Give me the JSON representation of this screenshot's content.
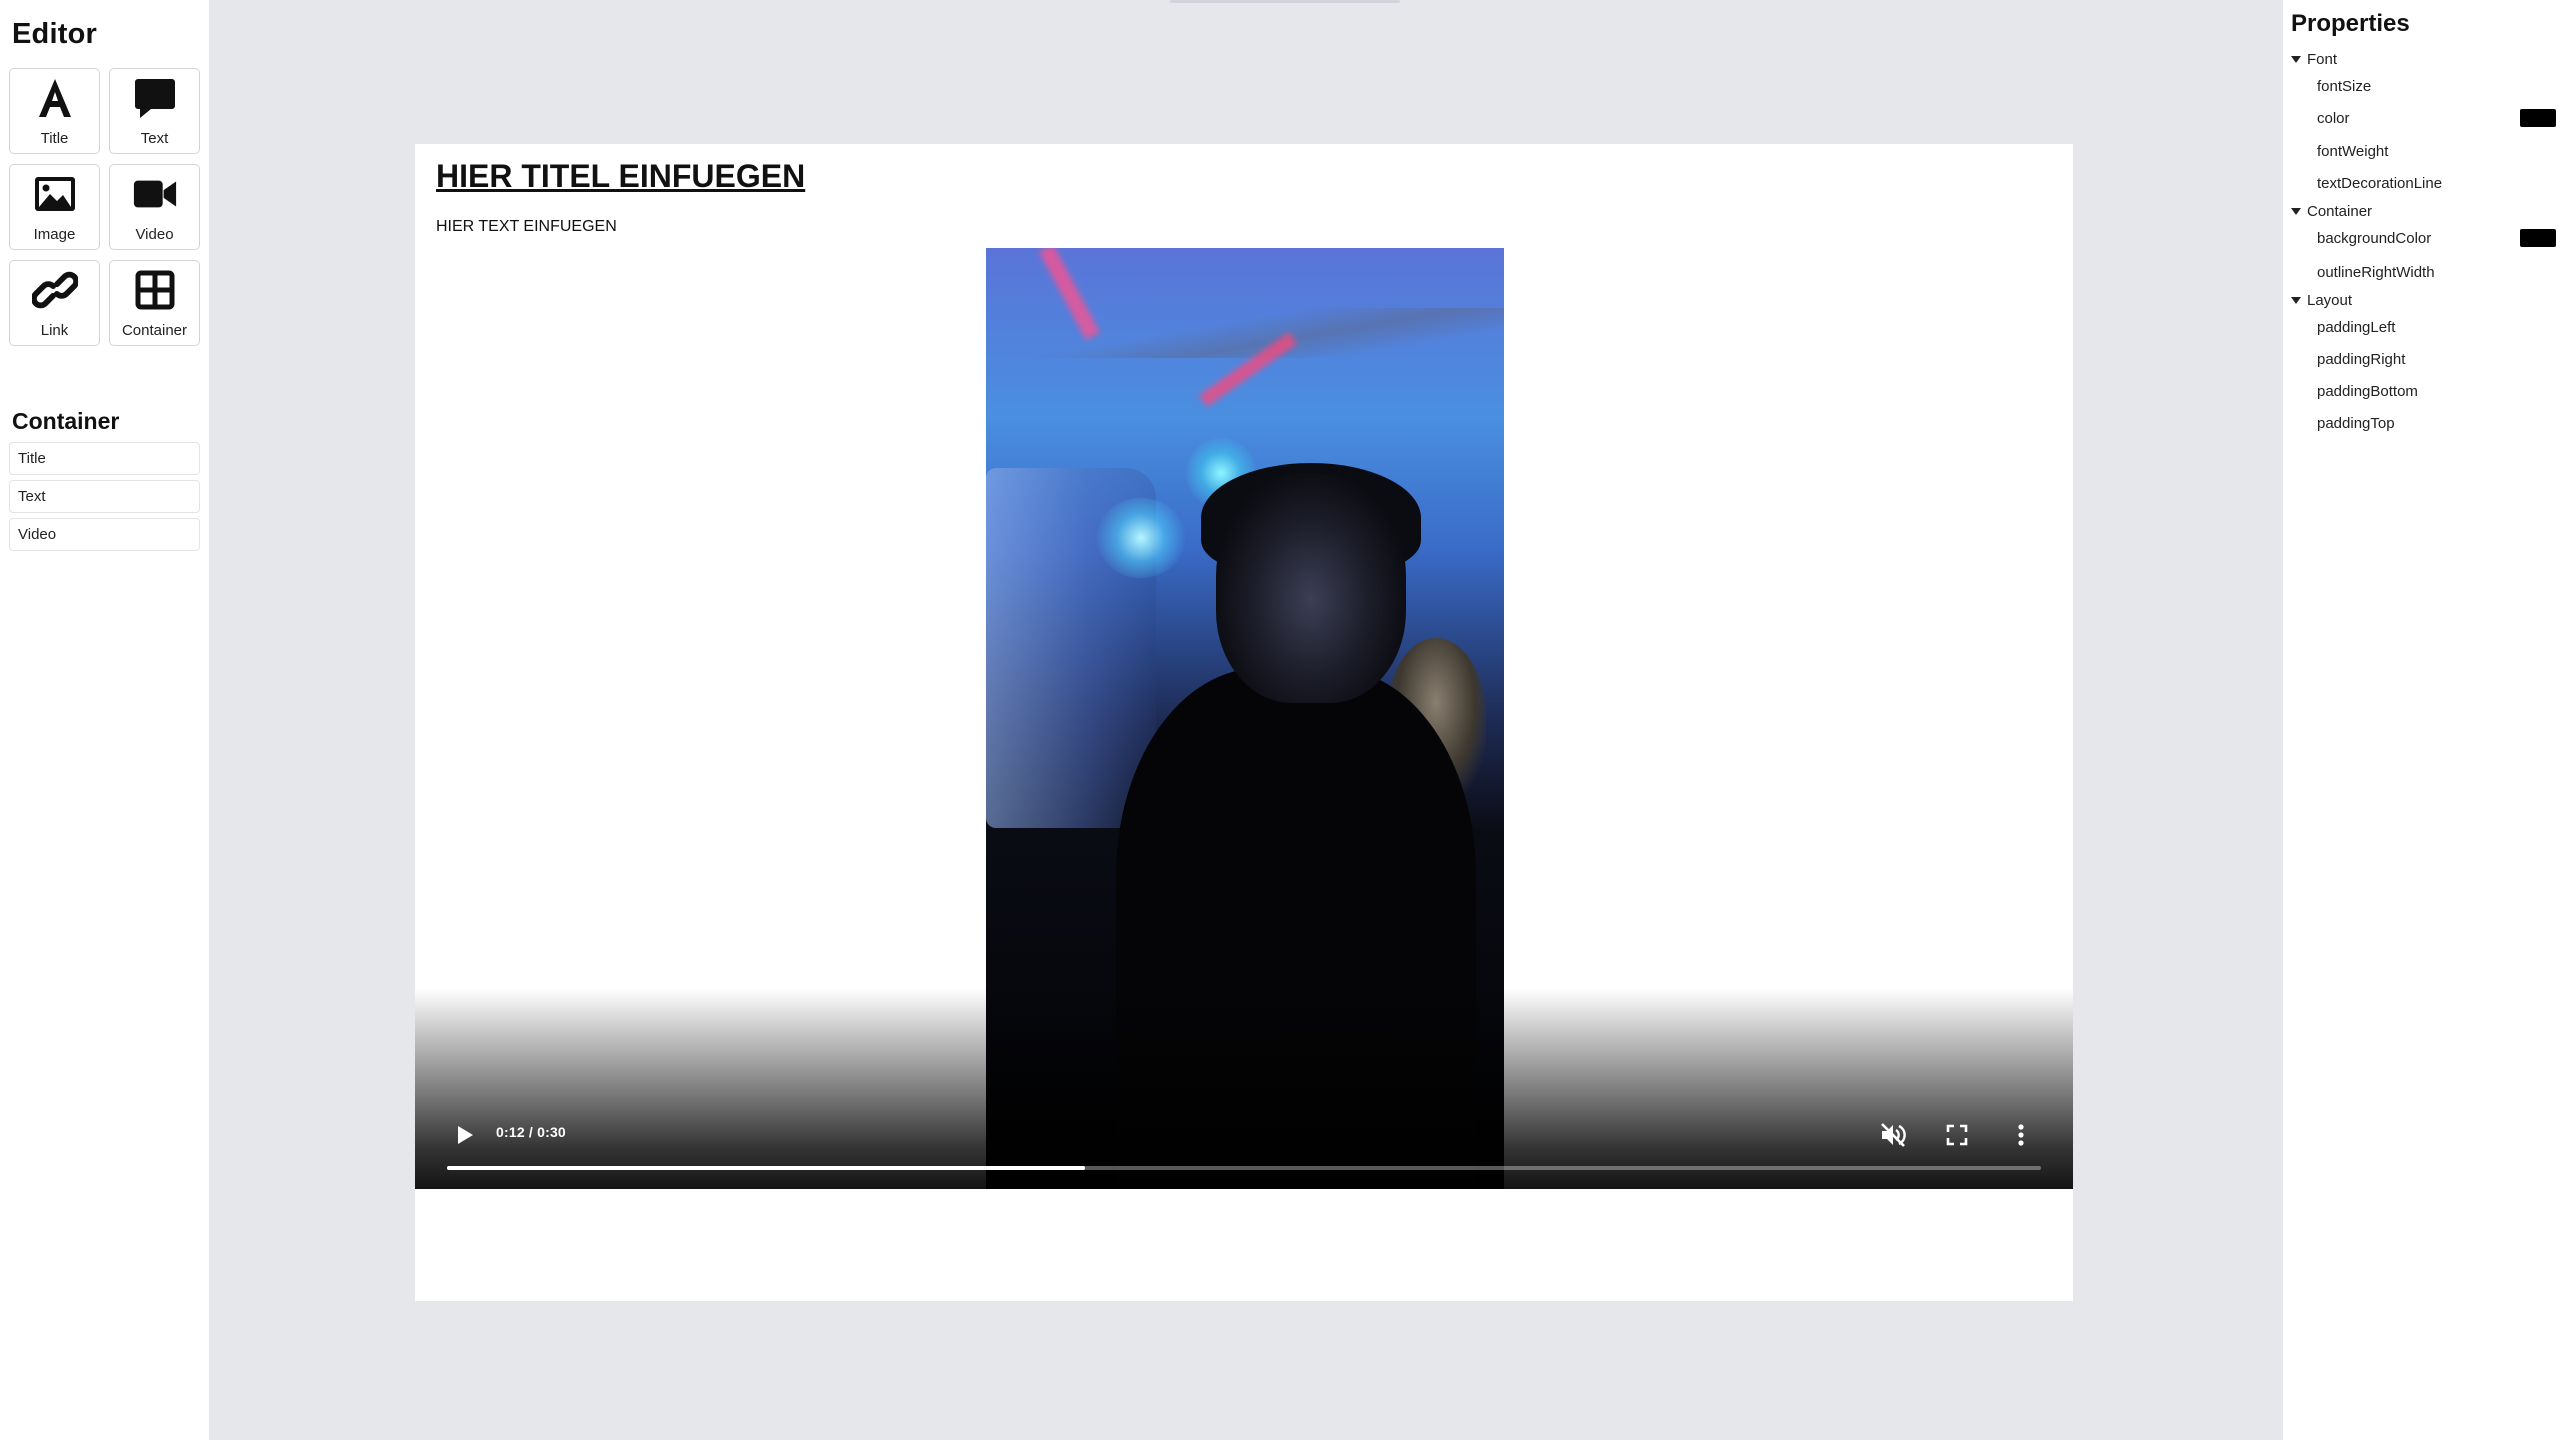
{
  "editor": {
    "title": "Editor",
    "tools": [
      {
        "label": "Title",
        "icon": "title-icon"
      },
      {
        "label": "Text",
        "icon": "text-bubble-icon"
      },
      {
        "label": "Image",
        "icon": "image-icon"
      },
      {
        "label": "Video",
        "icon": "video-camera-icon"
      },
      {
        "label": "Link",
        "icon": "link-icon"
      },
      {
        "label": "Container",
        "icon": "container-grid-icon"
      }
    ],
    "container_heading": "Container",
    "container_items": [
      "Title",
      "Text",
      "Video"
    ]
  },
  "canvas": {
    "page_title": "HIER TITEL EINFUEGEN",
    "page_text": "HIER TEXT EINFUEGEN",
    "video": {
      "time_display": "0:12 / 0:30",
      "progress": 0.4,
      "muted": true,
      "icons": [
        "play-icon",
        "mute-icon",
        "fullscreen-icon",
        "more-options-icon"
      ]
    }
  },
  "properties": {
    "title": "Properties",
    "groups": [
      {
        "name": "Font",
        "items": [
          {
            "label": "fontSize"
          },
          {
            "label": "color",
            "swatch": "#000000"
          },
          {
            "label": "fontWeight"
          },
          {
            "label": "textDecorationLine"
          }
        ]
      },
      {
        "name": "Container",
        "items": [
          {
            "label": "backgroundColor",
            "swatch": "#000000"
          },
          {
            "label": "outlineRightWidth"
          }
        ]
      },
      {
        "name": "Layout",
        "items": [
          {
            "label": "paddingLeft"
          },
          {
            "label": "paddingRight"
          },
          {
            "label": "paddingBottom"
          },
          {
            "label": "paddingTop"
          }
        ]
      }
    ]
  }
}
